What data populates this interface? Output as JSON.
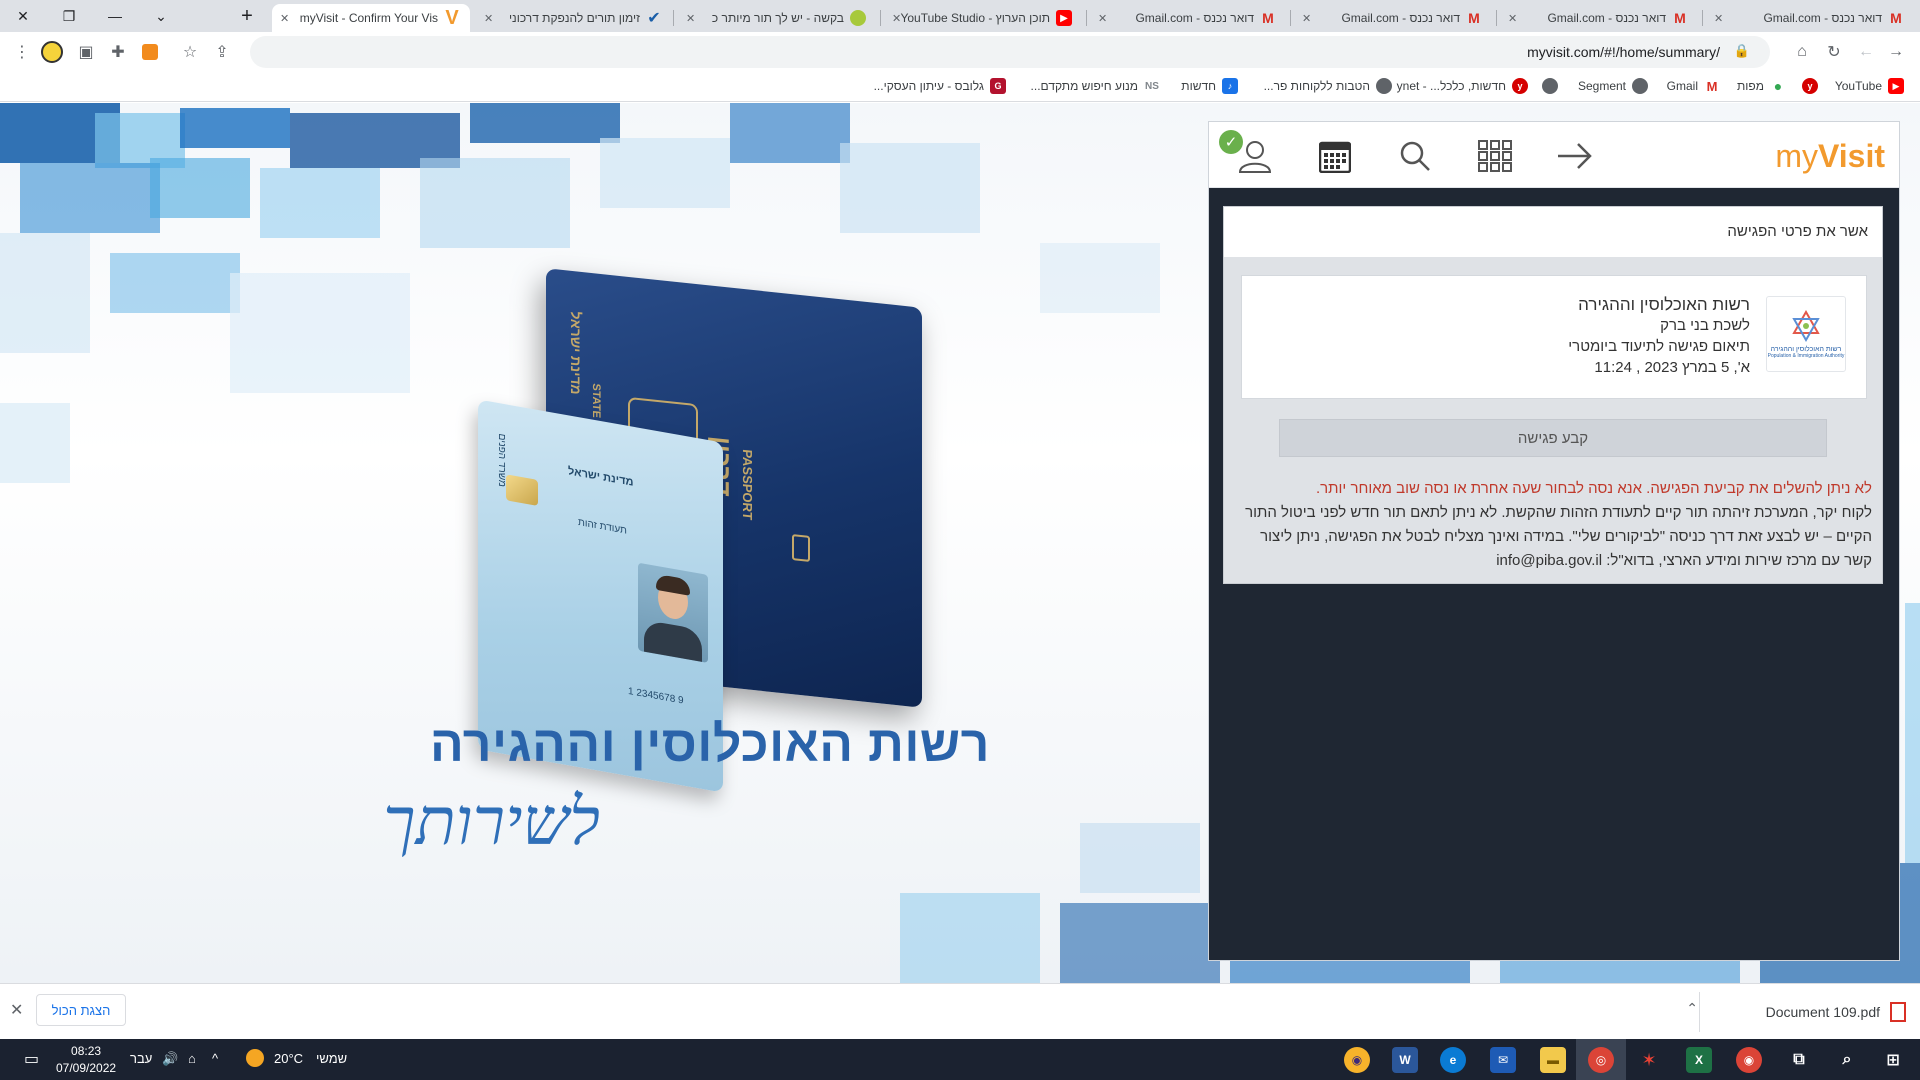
{
  "browser": {
    "tabs": [
      {
        "title": "myVisit - Confirm Your Vis",
        "icon": "myvisit-icon",
        "active": true
      },
      {
        "title": "זימון תורים להנפקת דרכוני",
        "icon": "check-icon"
      },
      {
        "title": "בקשה - יש לך תור מיותר כ",
        "icon": "app-icon"
      },
      {
        "title": "תוכן הערוץ - YouTube Studio",
        "icon": "youtube-icon"
      },
      {
        "title": "דואר נכנס - Gmail.com",
        "icon": "gmail-icon"
      },
      {
        "title": "דואר נכנס - Gmail.com",
        "icon": "gmail-icon"
      },
      {
        "title": "דואר נכנס - Gmail.com",
        "icon": "gmail-icon"
      },
      {
        "title": "דואר נכנס - Gmail.com",
        "icon": "gmail-icon"
      }
    ],
    "url": "myvisit.com/#!/home/summary/",
    "bookmarks": [
      {
        "label": "YouTube",
        "icon": "youtube-icon"
      },
      {
        "label": "",
        "icon": "ynet-icon"
      },
      {
        "label": "מפות",
        "icon": "maps-icon"
      },
      {
        "label": "Gmail",
        "icon": "gmail-icon"
      },
      {
        "label": "Segment",
        "icon": "globe-icon"
      },
      {
        "label": "",
        "icon": "globe-icon"
      },
      {
        "label": "חדשות, כלכל... - ynet",
        "icon": "ynet-icon"
      },
      {
        "label": "הטבות ללקוחות פר...",
        "icon": "globe-icon"
      },
      {
        "label": "חדשות",
        "icon": "news-icon"
      },
      {
        "label": "מנוע חיפוש מתקדם...",
        "icon": "search-engine-icon"
      },
      {
        "label": "גלובס - עיתון העסקי...",
        "icon": "globes-icon"
      }
    ]
  },
  "hero": {
    "title": "רשות האוכלוסין וההגירה",
    "script": "לשירותך",
    "passport_lines": [
      "מדינת ישראל",
      "STATE OF ISRAEL",
      "דרכון",
      "PASSPORT"
    ],
    "id_card_lines": [
      "מדינת ישראל",
      "תעודת זהות",
      "משרד הפנים",
      "1 2345678 9"
    ]
  },
  "panel": {
    "logo_my": "my",
    "logo_visit": "Visit",
    "nav_icons": [
      "user-icon",
      "calendar-icon",
      "search-icon",
      "grid-icon",
      "logout-arrow-icon"
    ],
    "confirm_header": "אשר את פרטי הפגישה",
    "appointment": {
      "org": "רשות האוכלוסין וההגירה",
      "branch": "לשכת בני ברק",
      "service": "תיאום פגישה לתיעוד ביומטרי",
      "datetime": "א', 5 במרץ 2023 , 11:24",
      "logo_text": "רשות האוכלוסין וההגירה",
      "logo_subtext": "Population & Immigration Authority"
    },
    "book_button": "קבע פגישה",
    "error_red": "לא ניתן להשלים את קביעת הפגישה. אנא נסה לבחור שעה אחרת או נסה שוב מאוחר יותר.",
    "error_info": "לקוח יקר, המערכת זיהתה תור קיים לתעודת הזהות שהקשת. לא ניתן לתאם תור חדש לפני ביטול התור הקיים – יש לבצע זאת דרך כניסה \"לביקורים שלי\". במידה ואינך מצליח לבטל את הפגישה, ניתן ליצור קשר עם מרכז שירות ומידע הארצי, בדוא\"ל: info@piba.gov.il"
  },
  "downloads": {
    "file": "Document 109.pdf",
    "show_all": "הצגת הכול"
  },
  "taskbar": {
    "time": "08:23",
    "date": "07/09/2022",
    "lang": "עבר",
    "weather": "20°C",
    "weather_desc": "שמשי"
  },
  "colors": {
    "accent": "#f29a2e",
    "panel_dark": "#1f2733",
    "hero_blue": "#2a63aa",
    "error_red": "#c0392b"
  }
}
